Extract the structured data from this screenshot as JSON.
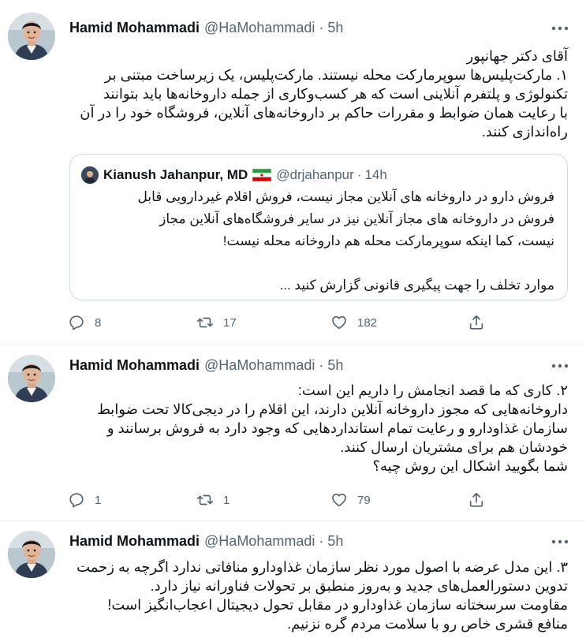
{
  "colors": {
    "text": "#0f1419",
    "secondary": "#536471",
    "border": "#cfd9de",
    "thread_line": "#cfd9de"
  },
  "tweets": [
    {
      "author_name": "Hamid Mohammadi",
      "handle": "@HaMohammadi",
      "separator": "·",
      "time": "5h",
      "lines": [
        "آقای دکتر جهانپور",
        "۱. مارکت‌پلیس‌ها سوپرمارکت محله نیستند. مارکت‌پلیس، یک زیرساخت مبتنی بر",
        "تکنولوژی و پلتفرم آنلاینی است که هر کسب‌وکاری از جمله داروخانه‌ها باید بتوانند",
        "با رعایت همان ضوابط و مقررات حاکم بر داروخانه‌های آنلاین، فروشگاه خود را در آن",
        "راه‌اندازی کنند."
      ],
      "quote": {
        "author_name": "Kianush Jahanpur, MD",
        "flag_icon": "iran-flag-icon",
        "handle": "@drjahanpur",
        "separator": "·",
        "time": "14h",
        "lines": [
          "فروش دارو در داروخانه های آنلاین مجاز نیست، فروش اقلام غیردارویی قابل",
          "فروش در داروخانه های مجاز آنلاین نیز در سایر فروشگاه‌های آنلاین مجاز",
          "نیست، کما اینکه سوپرمارکت محله هم داروخانه محله نیست!"
        ],
        "last_line": "موارد تخلف را جهت پیگیری قانونی گزارش کنید ..."
      },
      "replies": "8",
      "retweets": "17",
      "likes": "182"
    },
    {
      "author_name": "Hamid Mohammadi",
      "handle": "@HaMohammadi",
      "separator": "·",
      "time": "5h",
      "lines": [
        "۲. کاری که ما قصد انجامش را داریم این است:",
        "داروخانه‌هایی که مجوز داروخانه آنلاین دارند، این اقلام را در دیجی‌کالا تحت ضوابط",
        "سازمان غذاودارو و رعایت تمام استانداردهایی که وجود دارد به فروش برسانند و",
        "خودشان هم برای مشتریان ارسال کنند.",
        "شما بگویید اشکال این روش چیه؟"
      ],
      "replies": "1",
      "retweets": "1",
      "likes": "79"
    },
    {
      "author_name": "Hamid Mohammadi",
      "handle": "@HaMohammadi",
      "separator": "·",
      "time": "5h",
      "lines": [
        "۳. این مدل عرضه با اصول مورد نظر سازمان غذاودارو منافاتی ندارد اگرچه به زحمت",
        "تدوین دستورالعمل‌های جدید و به‌روز منطبق بر تحولات فناورانه نیاز دارد.",
        "مقاومت سرسختانه سازمان غذاودارو در مقابل تحول دیجیتال اعجاب‌انگیز است!",
        "منافع قشری خاص رو با سلامت مردم گره نزنیم."
      ]
    }
  ]
}
